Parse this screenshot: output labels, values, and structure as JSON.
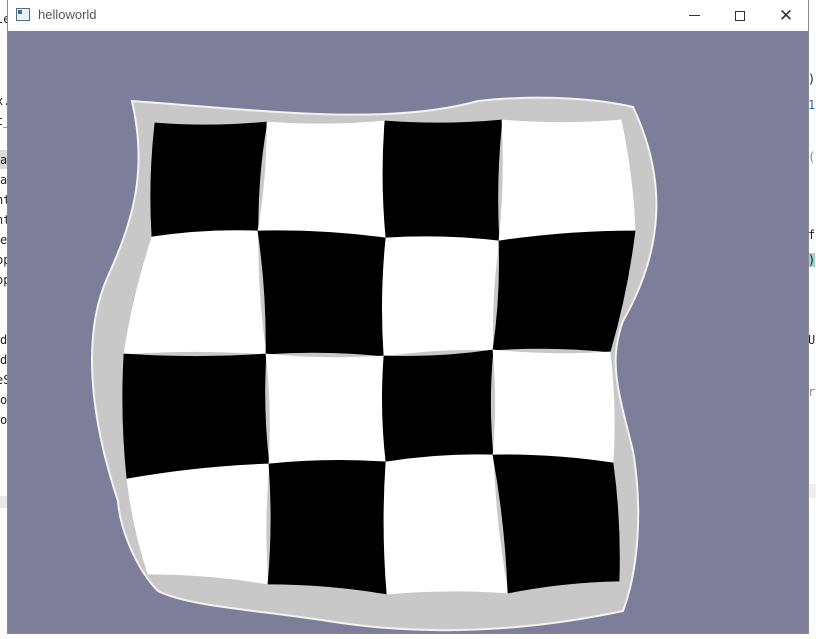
{
  "window": {
    "title": "helloworld",
    "controls": {
      "minimize": "minimize",
      "maximize": "maximize",
      "close": "close"
    }
  },
  "scene": {
    "background_color": "#7e7e9a",
    "border_color": "#c8c8c8",
    "dark_square_color": "#000000",
    "light_square_color": "#ffffff",
    "rows": 4,
    "cols": 4,
    "first_square": "dark"
  },
  "background_editor": {
    "left_fragments": [
      "le",
      "x.p",
      "t_",
      "a",
      "a",
      "nt",
      "nt",
      "e",
      "op",
      "op",
      "d",
      "d",
      "eS",
      "o",
      "o"
    ],
    "right_fragments": [
      ")",
      "1",
      "(",
      "f",
      ")",
      "U",
      "r"
    ]
  }
}
